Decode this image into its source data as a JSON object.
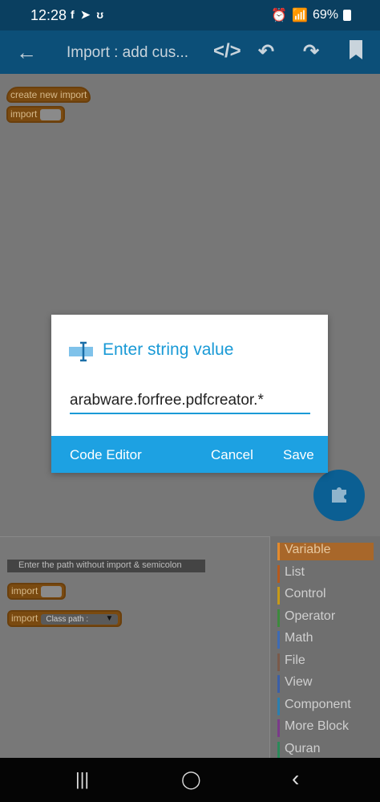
{
  "status_bar": {
    "time": "12:28",
    "left_icons": [
      "f",
      "➤",
      "ʊ"
    ],
    "signal_text": "📶",
    "battery_percent": "69%"
  },
  "app_bar": {
    "title": "Import : add cus...",
    "icons": [
      "back-icon",
      "code-icon",
      "undo-icon",
      "redo-icon",
      "bookmark-icon"
    ]
  },
  "workspace_top": {
    "blocks": [
      {
        "label": "create new import"
      },
      {
        "label": "import"
      }
    ]
  },
  "workspace_bottom": {
    "hint": "Enter the path without import & semicolon",
    "blocks": [
      {
        "label": "import"
      },
      {
        "label": "import",
        "dropdown": "Class path :"
      }
    ]
  },
  "palette": {
    "items": [
      {
        "label": "Variable",
        "color": "#e38b2e",
        "selected": true
      },
      {
        "label": "List",
        "color": "#b55a1e"
      },
      {
        "label": "Control",
        "color": "#c79a18"
      },
      {
        "label": "Operator",
        "color": "#3d8a3d"
      },
      {
        "label": "Math",
        "color": "#3d6bb5"
      },
      {
        "label": "File",
        "color": "#7a5a4a"
      },
      {
        "label": "View",
        "color": "#3a5fa8"
      },
      {
        "label": "Component",
        "color": "#2a7fb0"
      },
      {
        "label": "More Block",
        "color": "#7a3a8a"
      },
      {
        "label": "Quran",
        "color": "#2a8a5a"
      }
    ]
  },
  "dialog": {
    "title": "Enter string value",
    "input_value": "arabware.forfree.pdfcreator.*",
    "actions": {
      "code_editor": "Code Editor",
      "cancel": "Cancel",
      "save": "Save"
    },
    "accent_color": "#1da1e2"
  },
  "fab": {
    "icon": "puzzle-icon"
  },
  "nav_bar": {
    "recents": "|||",
    "home": "◯",
    "back": "‹"
  }
}
